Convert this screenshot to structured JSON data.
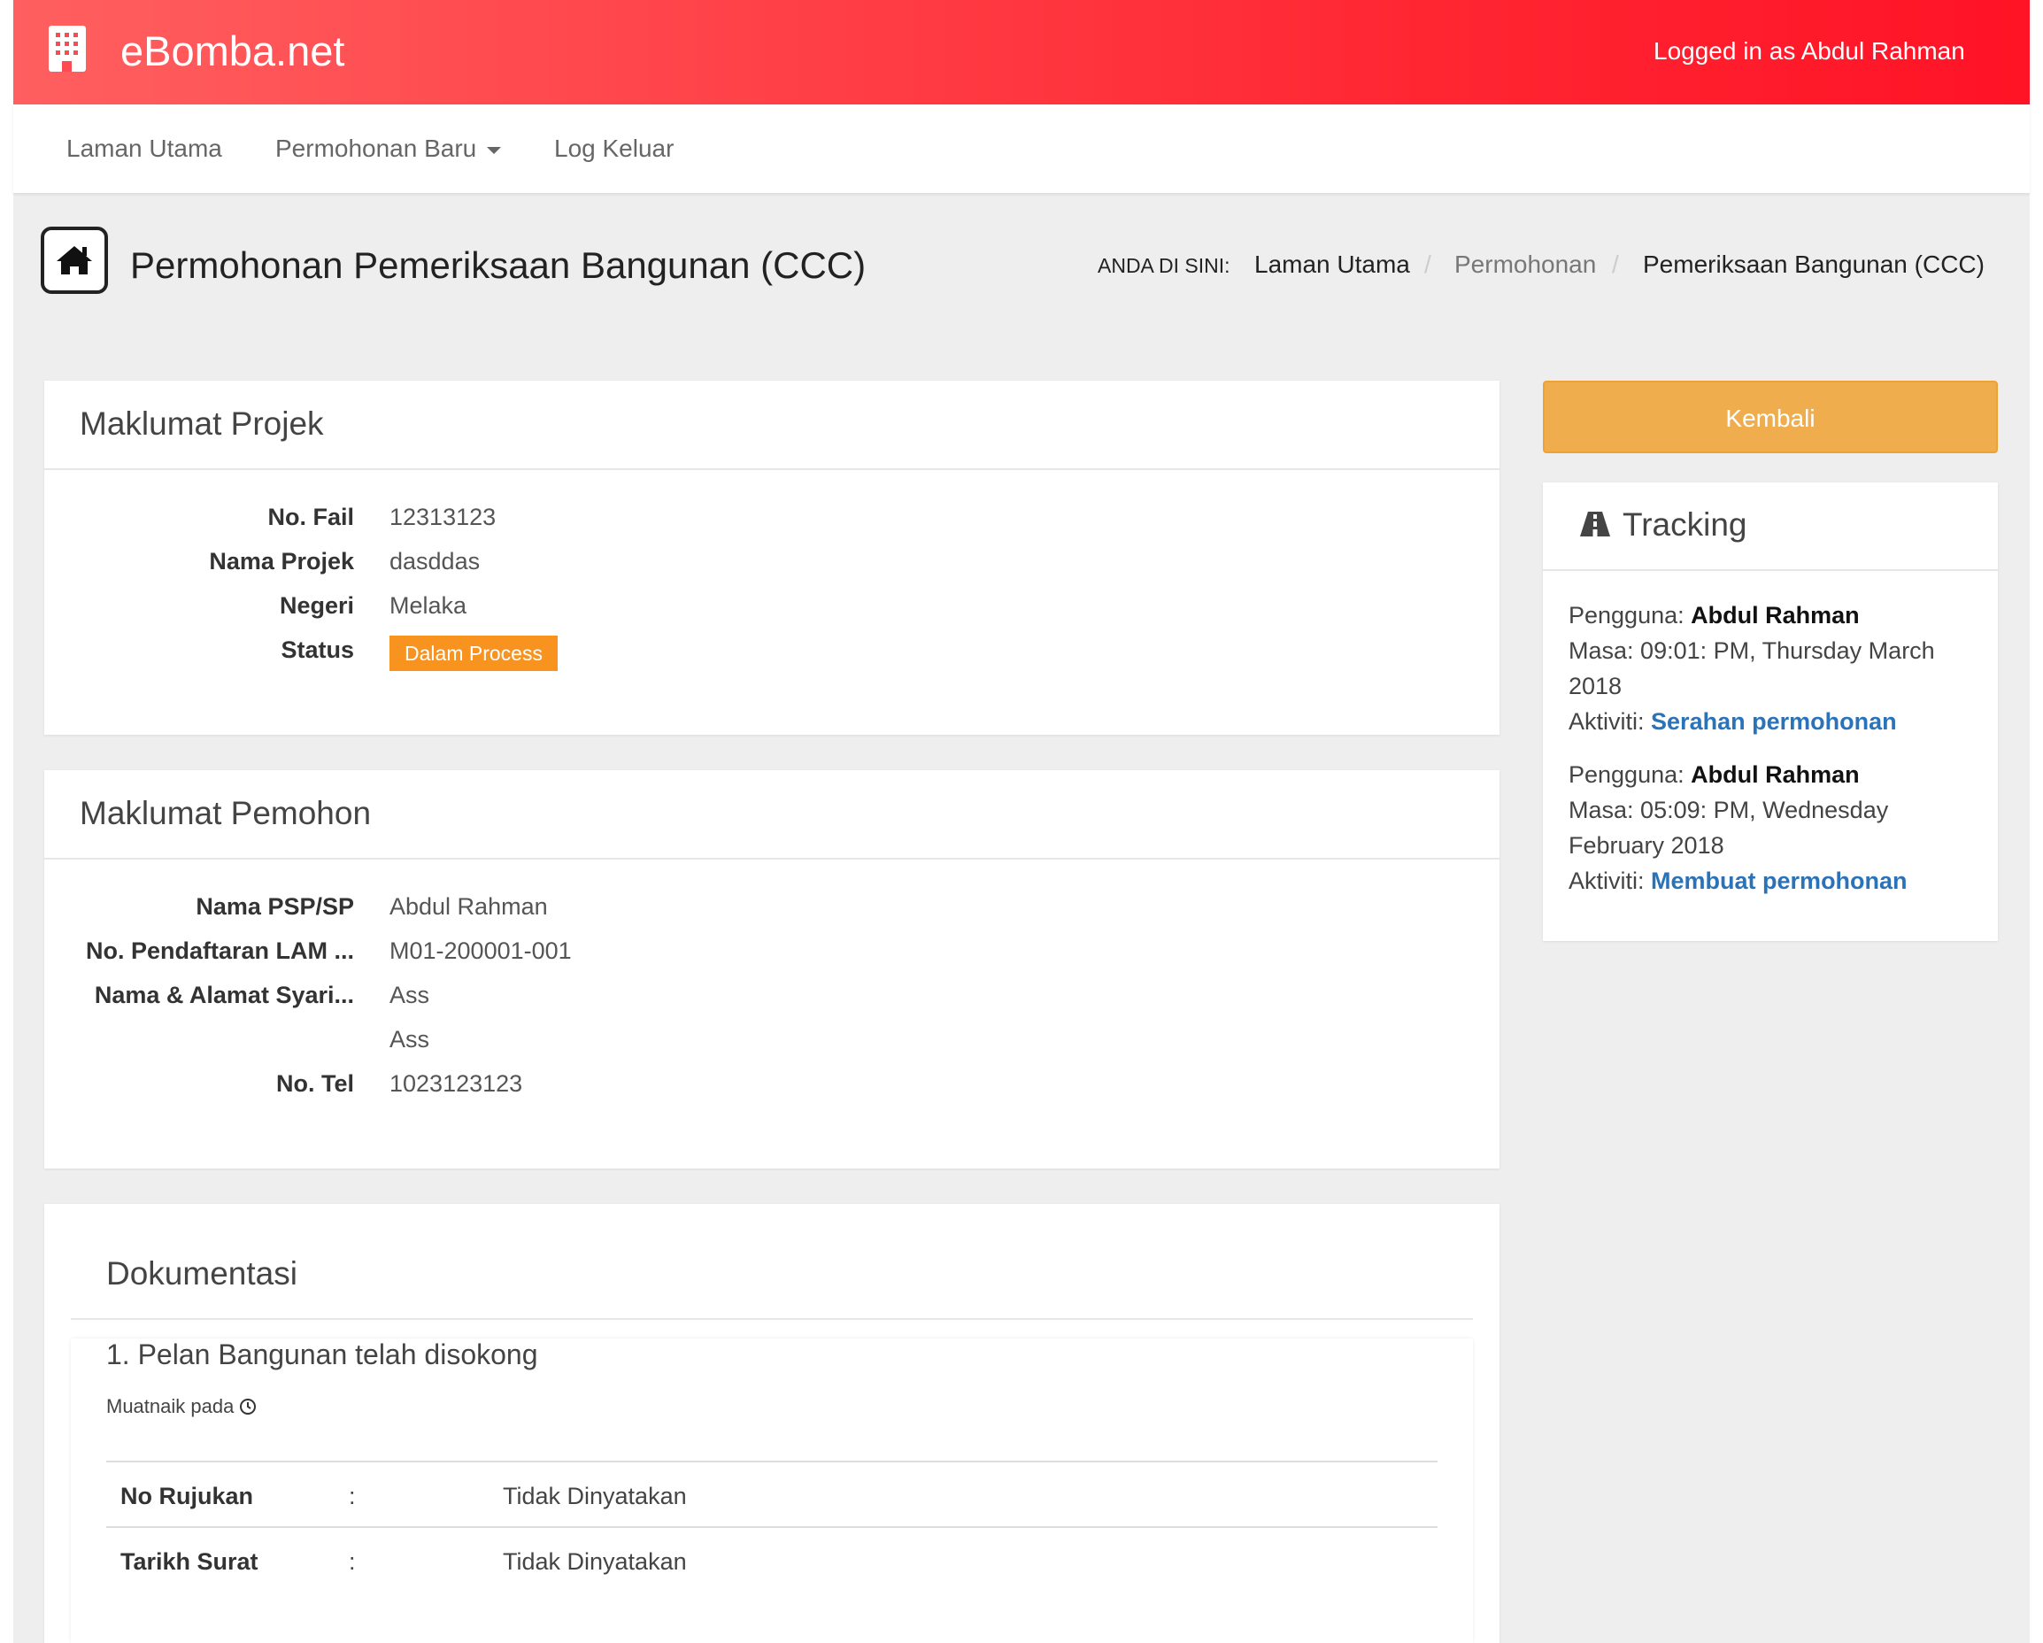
{
  "header": {
    "brand": "eBomba.net",
    "logged_in": "Logged in as Abdul Rahman"
  },
  "nav": {
    "items": [
      "Laman Utama",
      "Permohonan Baru",
      "Log Keluar"
    ]
  },
  "page": {
    "title": "Permohonan Pemeriksaan Bangunan (CCC)",
    "breadcrumb_label": "ANDA DI SINI:",
    "breadcrumb": [
      "Laman Utama",
      "Permohonan",
      "Pemeriksaan Bangunan (CCC)"
    ]
  },
  "projek": {
    "title": "Maklumat Projek",
    "fields": [
      {
        "label": "No. Fail",
        "value": "12313123"
      },
      {
        "label": "Nama Projek",
        "value": "dasddas"
      },
      {
        "label": "Negeri",
        "value": "Melaka"
      },
      {
        "label": "Status",
        "value": "Dalam Process"
      }
    ],
    "status_color": "#f7931e"
  },
  "pemohon": {
    "title": "Maklumat Pemohon",
    "fields": [
      {
        "label": "Nama PSP/SP",
        "value": "Abdul Rahman"
      },
      {
        "label": "No. Pendaftaran LAM ...",
        "value": "M01-200001-001"
      },
      {
        "label": "Nama & Alamat Syari...",
        "value": "Ass"
      },
      {
        "label": "",
        "value": "Ass"
      },
      {
        "label": "No. Tel",
        "value": "1023123123"
      }
    ]
  },
  "dokumentasi": {
    "title": "Dokumentasi",
    "item_title": "1. Pelan Bangunan telah disokong",
    "uploaded": "Muatnaik pada",
    "rows": [
      {
        "label": "No Rujukan",
        "sep": ":",
        "value": "Tidak Dinyatakan"
      },
      {
        "label": "Tarikh Surat",
        "sep": ":",
        "value": "Tidak Dinyatakan"
      }
    ]
  },
  "sidebar": {
    "back_button": "Kembali",
    "tracking_title": "Tracking",
    "labels": {
      "user": "Pengguna:",
      "time": "Masa:",
      "activity": "Aktiviti:"
    },
    "entries": [
      {
        "user": "Abdul Rahman",
        "time_line1": "09:01: PM, Thursday March",
        "time_line2": "2018",
        "activity": "Serahan permohonan"
      },
      {
        "user": "Abdul Rahman",
        "time_line1": "05:09: PM, Wednesday",
        "time_line2": "February 2018",
        "activity": "Membuat permohonan"
      }
    ]
  },
  "colors": {
    "header_start": "#ff5f60",
    "header_end": "#ff1326",
    "back_button": "#f0ad4e",
    "link": "#2a73b9"
  },
  "icons": [
    "building-icon",
    "home-icon",
    "road-icon",
    "clock-icon",
    "caret-down-icon"
  ]
}
